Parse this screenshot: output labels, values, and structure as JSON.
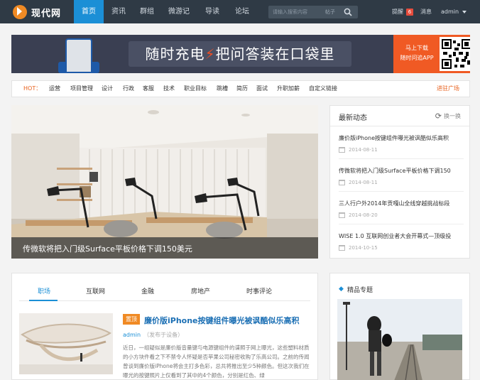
{
  "header": {
    "logo_text": "现代网",
    "nav": [
      "首页",
      "资讯",
      "群组",
      "微游记",
      "导读",
      "论坛"
    ],
    "search": {
      "placeholder": "请输入搜索内容",
      "scope": "帖子"
    },
    "reminders_label": "提醒",
    "reminders_count": "6",
    "messages_label": "消息",
    "user": "admin"
  },
  "banner": {
    "slogan_left": "随时充电",
    "slogan_right": "把问答装在口袋里",
    "cta_line1": "马上下载",
    "cta_line2": "随时问追APP"
  },
  "hot": {
    "label": "HOT：",
    "tags": [
      "运营",
      "项目管理",
      "设计",
      "行政",
      "客服",
      "技术",
      "职业目标",
      "跳槽",
      "简历",
      "面试",
      "升职加薪",
      "自定义链接"
    ],
    "more": "进驻广场"
  },
  "hero": {
    "caption": "传微软将把入门级Surface平板价格下调150美元"
  },
  "latest": {
    "title": "最新动态",
    "refresh": "换一换",
    "items": [
      {
        "title": "廉价版iPhone按键组件曝光被讽酷似乐高积",
        "date": "2014-08-11"
      },
      {
        "title": "传微软将把入门级Surface平板价格下调150",
        "date": "2014-08-11"
      },
      {
        "title": "三人行户外2014年贡嘎山全线穿越挑战标段",
        "date": "2014-08-20"
      },
      {
        "title": "WISE 1.0 互联网创业者大会开幕式—顶级投",
        "date": "2014-10-15"
      }
    ]
  },
  "feed": {
    "tabs": [
      "职场",
      "互联网",
      "金融",
      "房地产",
      "时事评论"
    ],
    "article": {
      "tag": "置顶",
      "title": "廉价版iPhone按键组件曝光被讽酷似乐高积",
      "author": "admin",
      "meta": "（发布于设备）",
      "body": "近日，一组疑似是廉价版音量键与电源键组件的谍照于网上曝光，这些塑料材质的小方块件看之下不禁令人怀疑是否苹果公司秘密收购了乐高公司。之前的传闻曾谈到廉价版iPhone将会主打多色彩，总共将推出至少5种颜色。但这次我们在曝光的按键照片上仅看到了其中的4个颜色，分别是红色、绿"
    }
  },
  "featured": {
    "title": "精品专题"
  },
  "colors": {
    "nav_bg": "#2f3a45",
    "accent": "#1b8fd6",
    "orange": "#f08a24"
  }
}
